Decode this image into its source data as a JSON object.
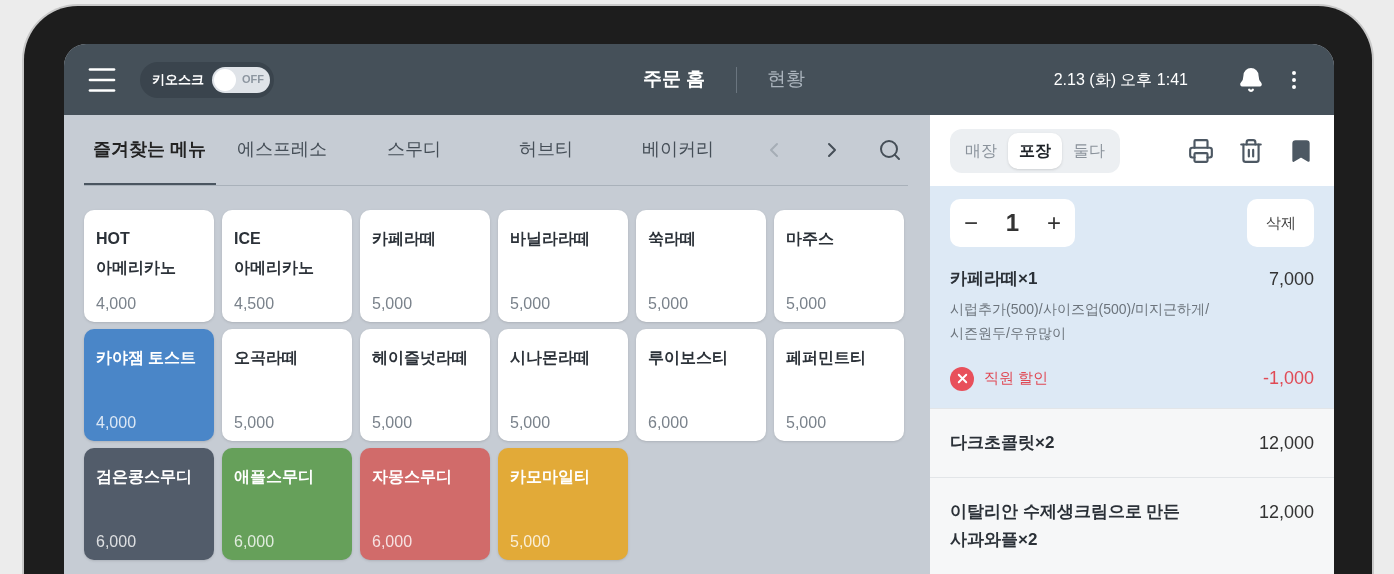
{
  "header": {
    "kiosk": {
      "label": "키오스크",
      "on": false,
      "state_text": "OFF"
    },
    "nav": [
      {
        "label": "주문 홈",
        "selected": true
      },
      {
        "label": "현황",
        "selected": false
      }
    ],
    "datetime": "2.13 (화) 오후 1:41"
  },
  "categories": [
    {
      "label": "즐겨찾는 메뉴",
      "selected": true
    },
    {
      "label": "에스프레소",
      "selected": false
    },
    {
      "label": "스무디",
      "selected": false
    },
    {
      "label": "허브티",
      "selected": false
    },
    {
      "label": "베이커리",
      "selected": false
    }
  ],
  "menu_items": [
    {
      "name": "HOT\n아메리카노",
      "price": "4,000",
      "color": "#ffffff"
    },
    {
      "name": "ICE\n아메리카노",
      "price": "4,500",
      "color": "#ffffff"
    },
    {
      "name": "카페라떼",
      "price": "5,000",
      "color": "#ffffff"
    },
    {
      "name": "바닐라라떼",
      "price": "5,000",
      "color": "#ffffff"
    },
    {
      "name": "쑥라떼",
      "price": "5,000",
      "color": "#ffffff"
    },
    {
      "name": "마주스",
      "price": "5,000",
      "color": "#ffffff"
    },
    {
      "name": "카야잼 토스트",
      "price": "4,000",
      "color": "#4a86c8"
    },
    {
      "name": "오곡라떼",
      "price": "5,000",
      "color": "#ffffff"
    },
    {
      "name": "헤이즐넛라떼",
      "price": "5,000",
      "color": "#ffffff"
    },
    {
      "name": "시나몬라떼",
      "price": "5,000",
      "color": "#ffffff"
    },
    {
      "name": "루이보스티",
      "price": "6,000",
      "color": "#ffffff"
    },
    {
      "name": "페퍼민트티",
      "price": "5,000",
      "color": "#ffffff"
    },
    {
      "name": "검은콩스무디",
      "price": "6,000",
      "color": "#525c6a"
    },
    {
      "name": "애플스무디",
      "price": "6,000",
      "color": "#66a05a"
    },
    {
      "name": "자몽스무디",
      "price": "6,000",
      "color": "#d16b6a"
    },
    {
      "name": "카모마일티",
      "price": "5,000",
      "color": "#e2aa38"
    }
  ],
  "order_type": [
    {
      "label": "매장",
      "selected": false
    },
    {
      "label": "포장",
      "selected": true
    },
    {
      "label": "둘다",
      "selected": false
    }
  ],
  "order_items": [
    {
      "selected": true,
      "minus": "−",
      "quantity": "1",
      "plus": "+",
      "delete": "삭제",
      "name": "카페라떼×1",
      "price": "7,000",
      "options": [
        "시럽추가(500)/사이즈업(500)/미지근하게/",
        "시즌원두/우유많이"
      ],
      "discount": {
        "label": "직원 할인",
        "amount": "-1,000"
      }
    },
    {
      "selected": false,
      "name": "다크초콜릿×2",
      "price": "12,000"
    },
    {
      "selected": false,
      "name": "이탈리안 수제생크림으로 만든\n사과와플×2",
      "price": "12,000"
    }
  ]
}
